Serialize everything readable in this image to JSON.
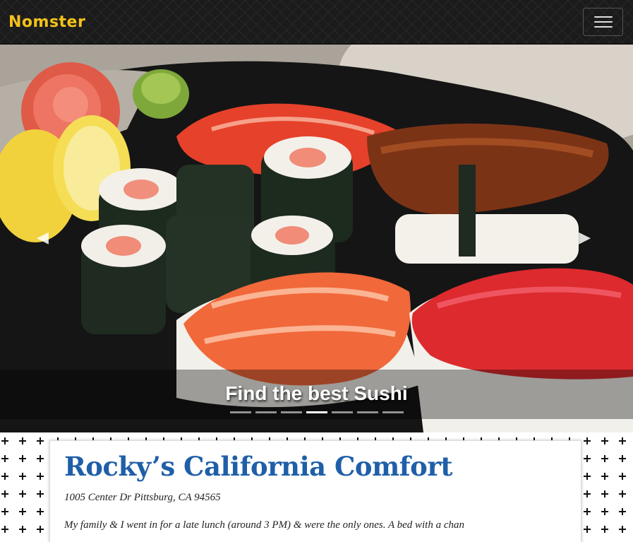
{
  "navbar": {
    "brand": "Nomster",
    "toggle_icon": "hamburger-menu-icon"
  },
  "carousel": {
    "caption": "Find the best Sushi",
    "prev_icon": "chevron-left-icon",
    "next_icon": "chevron-right-icon",
    "prev_label": "Previous",
    "next_label": "Next",
    "indicator_count": 7,
    "active_indicator": 4
  },
  "place": {
    "name": "Rocky’s California Comfort",
    "address": "1005 Center Dr Pittsburg, CA 94565",
    "description": "My family & I went in for a late lunch (around 3 PM) & were the only ones. A bed with a chan"
  },
  "colors": {
    "brand": "#f2c21b",
    "title": "#1f5fa8"
  }
}
